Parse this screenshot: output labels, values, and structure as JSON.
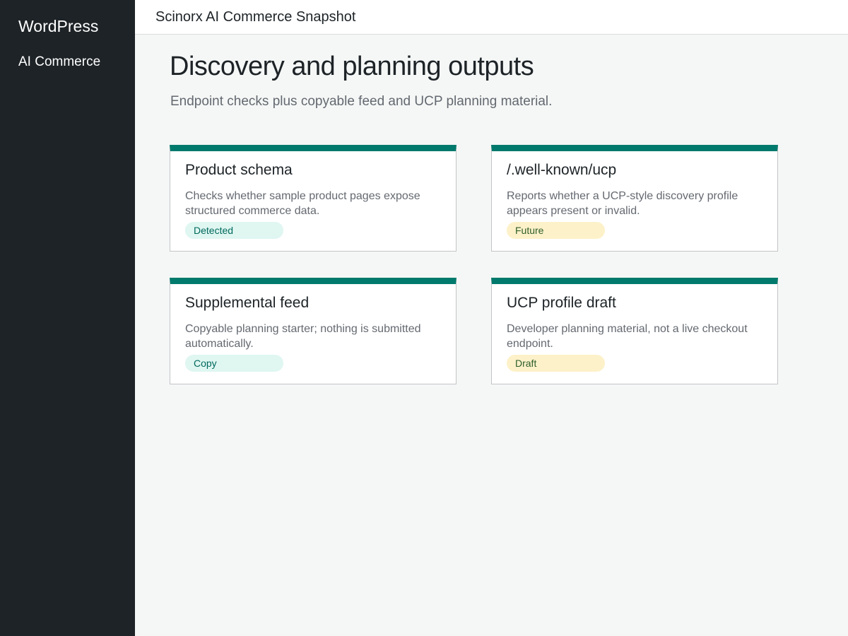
{
  "sidebar": {
    "brand": "WordPress",
    "items": [
      {
        "label": "AI Commerce"
      }
    ]
  },
  "topbar": {
    "title": "Scinorx AI Commerce Snapshot"
  },
  "main": {
    "title": "Discovery and planning outputs",
    "subtitle": "Endpoint checks plus copyable feed and UCP planning material.",
    "cards": [
      {
        "title": "Product schema",
        "description": "Checks whether sample product pages expose structured commerce data.",
        "badge": "Detected",
        "badge_tone": "green"
      },
      {
        "title": "/.well-known/ucp",
        "description": "Reports whether a UCP-style discovery profile appears present or invalid.",
        "badge": "Future",
        "badge_tone": "yellow"
      },
      {
        "title": "Supplemental feed",
        "description": "Copyable planning starter; nothing is submitted automatically.",
        "badge": "Copy",
        "badge_tone": "green"
      },
      {
        "title": "UCP profile draft",
        "description": "Developer planning material, not a live checkout endpoint.",
        "badge": "Draft",
        "badge_tone": "yellow"
      }
    ]
  },
  "colors": {
    "sidebar_bg": "#1e2327",
    "accent": "#007a6c",
    "badge_green_bg": "#dff6f1",
    "badge_yellow_bg": "#fdf1c9"
  }
}
